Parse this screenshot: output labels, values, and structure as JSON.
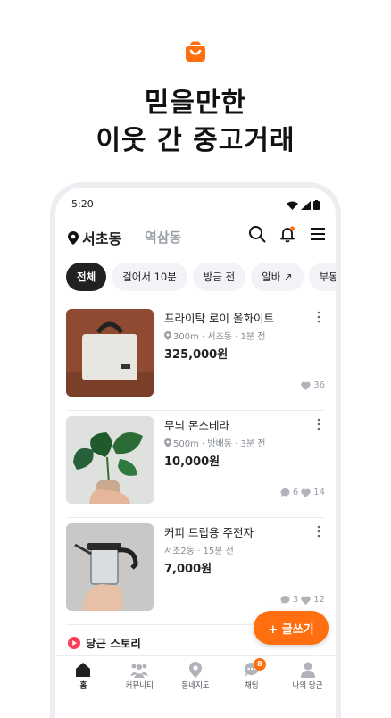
{
  "hero": {
    "line1": "믿을만한",
    "line2": "이웃 간 중고거래"
  },
  "status_bar": {
    "time": "5:20"
  },
  "app_bar": {
    "location": "서초동",
    "secondary_location": "역삼동"
  },
  "chips": [
    "전체",
    "걸어서 10분",
    "방금 전",
    "알바 ↗",
    "부동"
  ],
  "items": [
    {
      "title": "프라이탁 로이 올화이트",
      "meta": "300m · 서초동 · 1분 전",
      "price": "325,000원",
      "chats": "",
      "likes": "36"
    },
    {
      "title": "무늬 몬스테라",
      "meta": "500m · 방배동 · 3분 전",
      "price": "10,000원",
      "chats": "6",
      "likes": "14"
    },
    {
      "title": "커피 드립용 주전자",
      "meta": "서초2동 · 15분 전",
      "price": "7,000원",
      "chats": "3",
      "likes": "12"
    }
  ],
  "story": {
    "label": "당근 스토리"
  },
  "fab": {
    "label": "+ 글쓰기"
  },
  "nav": [
    {
      "label": "홈"
    },
    {
      "label": "커뮤니티"
    },
    {
      "label": "동네지도"
    },
    {
      "label": "채팅",
      "badge": "8"
    },
    {
      "label": "나의 당근"
    }
  ],
  "colors": {
    "accent": "#ff6f0f",
    "text": "#212124",
    "muted": "#868b94"
  }
}
